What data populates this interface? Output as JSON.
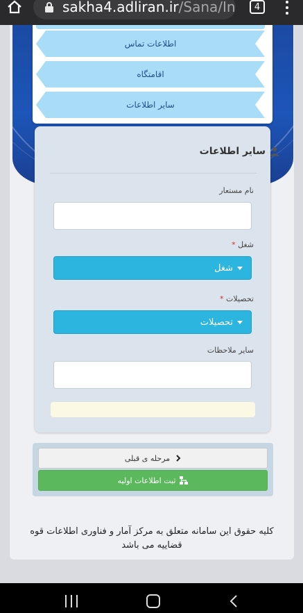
{
  "browser": {
    "url_host": "sakha4.adliran.ir",
    "url_path": "/Sana/Inde",
    "tab_count": "4"
  },
  "menu": {
    "items": [
      {
        "label": "اطلاعات تماس"
      },
      {
        "label": "اقامتگاه"
      },
      {
        "label": "سایر اطلاعات"
      }
    ]
  },
  "form": {
    "title": "سایر اطلاعات",
    "fields": {
      "alias_label": "نام مستعار",
      "alias_value": "",
      "job_label": "شغل",
      "job_selected": "شغل",
      "education_label": "تحصیلات",
      "education_selected": "تحصیلات",
      "notes_label": "سایر ملاحظات",
      "notes_value": ""
    },
    "required_mark": "*"
  },
  "buttons": {
    "prev_label": "مرحله ی قبلی",
    "submit_label": "ثبت اطلاعات اولیه"
  },
  "footer": {
    "text": "کلیه حقوق این سامانه متعلق به مرکز آمار و فناوری اطلاعات قوه قضاییه می باشد"
  },
  "colors": {
    "select_bg": "#2cb5df",
    "submit_bg": "#5cb85c",
    "menu_item_bg": "#a9dcf7",
    "hero_bg": "#1d55b8"
  }
}
